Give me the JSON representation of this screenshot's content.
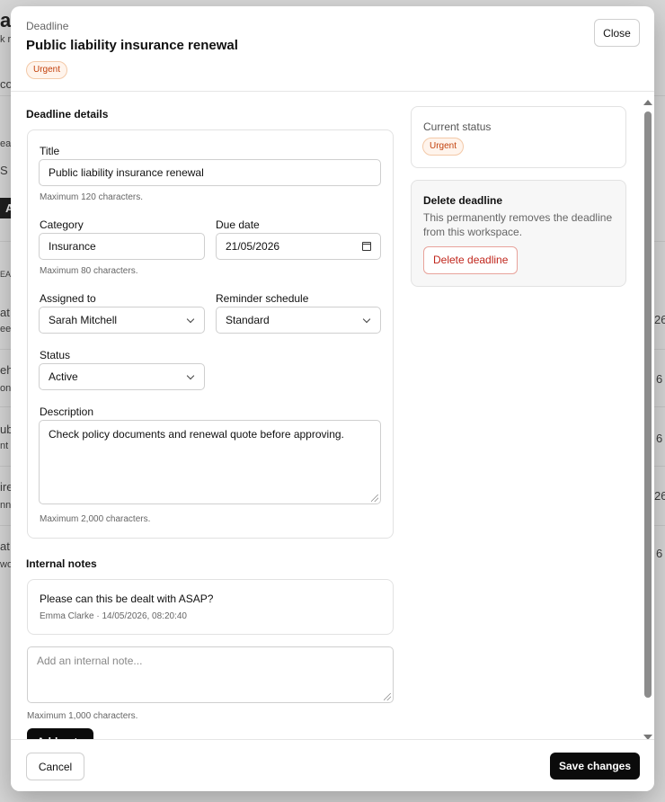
{
  "background": {
    "fragments": [
      "ad",
      "k r",
      "con",
      "ea",
      "S",
      "A",
      "EA",
      "at",
      "ee",
      "eh",
      "on",
      "ub",
      "nt",
      "ire",
      "nn",
      "at",
      "wo",
      "26",
      "6",
      "6",
      "26",
      "6"
    ]
  },
  "modal": {
    "eyebrow": "Deadline",
    "title": "Public liability insurance renewal",
    "badge": "Urgent",
    "close_label": "Close"
  },
  "details": {
    "section_title": "Deadline details",
    "title_label": "Title",
    "title_value": "Public liability insurance renewal",
    "title_help": "Maximum 120 characters.",
    "category_label": "Category",
    "category_value": "Insurance",
    "category_help": "Maximum 80 characters.",
    "due_label": "Due date",
    "due_value": "21/05/2026",
    "assigned_label": "Assigned to",
    "assigned_value": "Sarah Mitchell",
    "reminder_label": "Reminder schedule",
    "reminder_value": "Standard",
    "status_label": "Status",
    "status_value": "Active",
    "description_label": "Description",
    "description_value": "Check policy documents and renewal quote before approving.",
    "description_help": "Maximum 2,000 characters."
  },
  "notes": {
    "section_title": "Internal notes",
    "items": [
      {
        "text": "Please can this be dealt with ASAP?",
        "meta": "Emma Clarke · 14/05/2026, 08:20:40"
      }
    ],
    "input_placeholder": "Add an internal note...",
    "input_help": "Maximum 1,000 characters.",
    "add_label": "Add note"
  },
  "sidebar": {
    "status_title": "Current status",
    "status_badge": "Urgent",
    "delete_title": "Delete deadline",
    "delete_desc": "This permanently removes the deadline from this workspace.",
    "delete_label": "Delete deadline"
  },
  "footer": {
    "cancel_label": "Cancel",
    "save_label": "Save changes"
  },
  "colors": {
    "urgent": "#c2410c",
    "danger": "#c0261c",
    "primary": "#0b0b0b"
  }
}
